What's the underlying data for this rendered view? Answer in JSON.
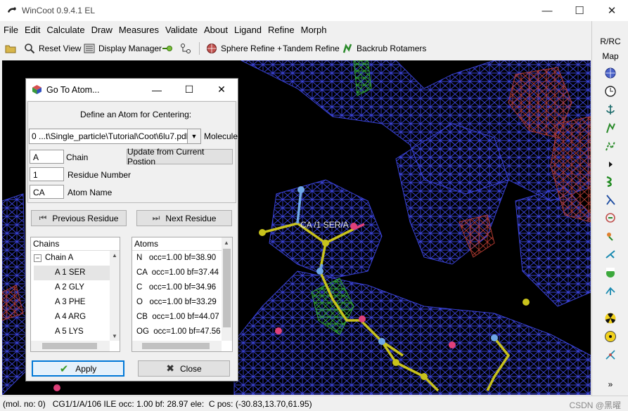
{
  "app": {
    "title": "WinCoot 0.9.4.1 EL",
    "minimize": "—",
    "maximize": "☐",
    "close": "✕"
  },
  "menu": [
    "File",
    "Edit",
    "Calculate",
    "Draw",
    "Measures",
    "Validate",
    "About",
    "Ligand",
    "Refine",
    "Morph"
  ],
  "toolbar": {
    "reset_view": "Reset View",
    "display_manager": "Display Manager",
    "sphere_refine": "Sphere Refine +",
    "tandem_refine": "Tandem Refine",
    "backrub": "Backrub Rotamers"
  },
  "right_toolbar": {
    "rrc": "R/RC",
    "map": "Map",
    "more": "»"
  },
  "viewport": {
    "atom_label": "CA /1 SER/A",
    "colors": {
      "map": "#3a43d8",
      "diff_neg": "#c0342c",
      "diff_pos": "#2ea52e",
      "bonds": "#c8c21c",
      "n_atom": "#6fa8e8",
      "o_atom": "#e0407a"
    }
  },
  "dialog": {
    "title": "Go To Atom...",
    "header": "Define an Atom for Centering:",
    "molecule_value": "0   ...t\\Single_particle\\Tutorial\\Coot\\6lu7.pdb",
    "molecule_label": "Molecule",
    "chain_value": "A",
    "chain_label": "Chain",
    "update_button": "Update from Current Postion",
    "residue_value": "1",
    "residue_label": "Residue Number",
    "atom_value": "CA",
    "atom_label": "Atom Name",
    "prev_button": "Previous Residue",
    "next_button": "Next Residue",
    "chains_header": "Chains",
    "chain_group": "Chain A",
    "chains": [
      "A 1 SER",
      "A 2 GLY",
      "A 3 PHE",
      "A 4 ARG",
      "A 5 LYS"
    ],
    "atoms_header": "Atoms",
    "atoms": [
      "N   occ=1.00 bf=38.90",
      "CA  occ=1.00 bf=37.44",
      "C   occ=1.00 bf=34.96",
      "O   occ=1.00 bf=33.29",
      "CB  occ=1.00 bf=44.07",
      "OG  occ=1.00 bf=47.56"
    ],
    "apply_button": "Apply",
    "close_button": "Close"
  },
  "status": {
    "text": "(mol. no: 0)   CG1/1/A/106 ILE occ: 1.00 bf: 28.97 ele:  C pos: (-30.83,13.70,61.95)",
    "watermark": "CSDN @黑曜"
  }
}
